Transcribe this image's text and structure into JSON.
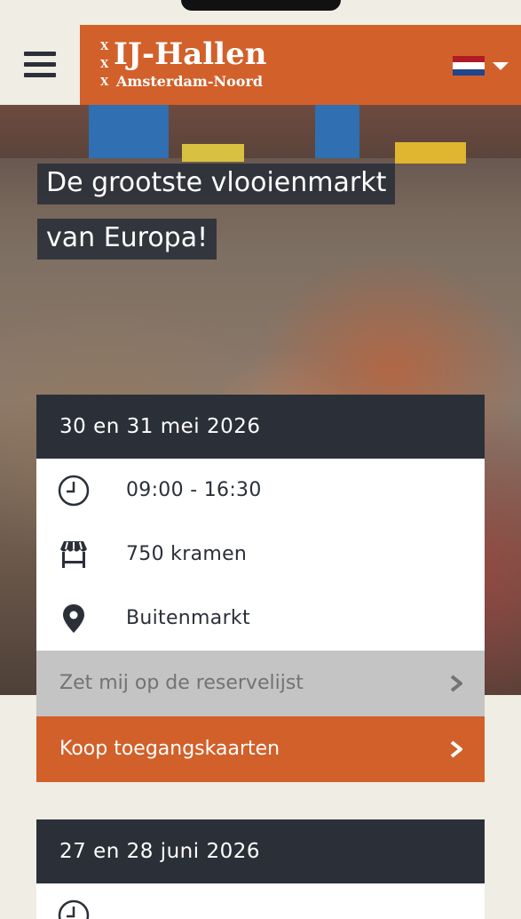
{
  "header": {
    "logo_x_marks": [
      "X",
      "X",
      "X"
    ],
    "logo_title": "IJ-Hallen",
    "logo_subtitle": "Amsterdam-Noord",
    "language_flag": "netherlands-flag",
    "flag_colors": [
      "#ae1c28",
      "#ffffff",
      "#21468b"
    ]
  },
  "hero": {
    "title_line1": "De grootste vlooienmarkt",
    "title_line2": "van Europa!"
  },
  "events": [
    {
      "date": "30 en 31 mei 2026",
      "time": "09:00 - 16:30",
      "stalls": "750 kramen",
      "location": "Buitenmarkt",
      "reserve_label": "Zet mij op de reservelijst",
      "buy_label": "Koop toegangskaarten"
    },
    {
      "date": "27 en 28 juni 2026"
    }
  ],
  "colors": {
    "accent": "#d2602a",
    "dark": "#2b3038",
    "background": "#efede4",
    "disabled": "#c4c4c4"
  },
  "icons": {
    "menu": "hamburger-menu-icon",
    "time": "clock-icon",
    "stalls": "market-stall-icon",
    "location": "map-pin-icon",
    "chevron": "chevron-right-icon"
  }
}
